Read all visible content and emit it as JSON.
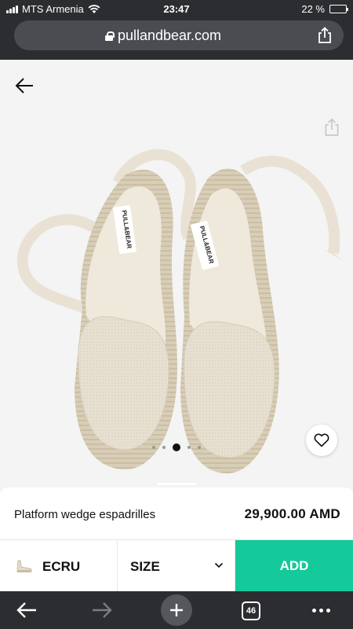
{
  "status_bar": {
    "carrier": "MTS Armenia",
    "time": "23:47",
    "battery": "22 %",
    "battery_level": 0.22
  },
  "browser": {
    "url": "pullandbear.com",
    "tab_count": "46"
  },
  "product": {
    "name": "Platform wedge espadrilles",
    "price": "29,900.00 AMD",
    "label_text": "PULL&BEAR",
    "image_index": 3,
    "image_count": 5
  },
  "actions": {
    "color": "ECRU",
    "size": "SIZE",
    "add": "ADD"
  },
  "colors": {
    "add_button": "#14c99a",
    "chrome": "#2b2d31",
    "battery": "#f5d020"
  }
}
